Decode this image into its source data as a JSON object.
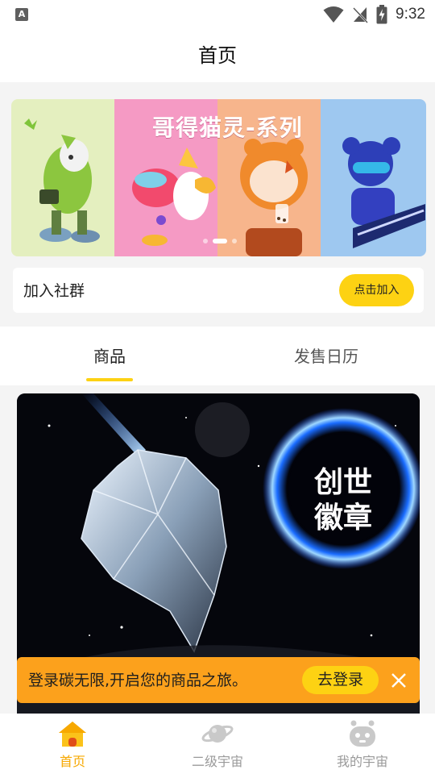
{
  "status_bar": {
    "time": "9:32",
    "app_icon_letter": "A"
  },
  "header": {
    "title": "首页"
  },
  "banner": {
    "title": "哥得猫灵-系列",
    "slide_count": 3,
    "active_slide": 2
  },
  "community": {
    "label": "加入社群",
    "button": "点击加入"
  },
  "tabs": [
    {
      "label": "商品",
      "active": true
    },
    {
      "label": "发售日历",
      "active": false
    }
  ],
  "product": {
    "badge_text_line1": "创世",
    "badge_text_line2": "徽章"
  },
  "login_bar": {
    "message": "登录碳无限,开启您的商品之旅。",
    "button": "去登录"
  },
  "bottom_nav": [
    {
      "label": "首页",
      "icon": "home-icon",
      "active": true
    },
    {
      "label": "二级宇宙",
      "icon": "planet-icon",
      "active": false
    },
    {
      "label": "我的宇宙",
      "icon": "robot-face-icon",
      "active": false
    }
  ],
  "colors": {
    "accent": "#fdd213",
    "toast": "#fca11c",
    "nav_active": "#f7a800"
  }
}
